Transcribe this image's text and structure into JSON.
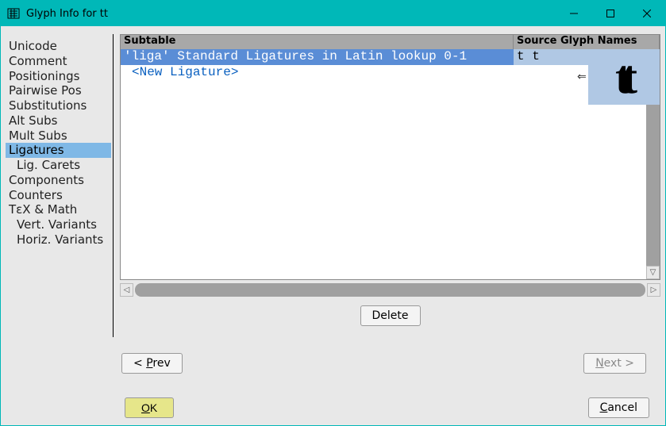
{
  "titlebar": {
    "title": "Glyph Info for tt"
  },
  "sidebar": {
    "items": [
      {
        "label": "Unicode",
        "indent": false,
        "selected": false
      },
      {
        "label": "Comment",
        "indent": false,
        "selected": false
      },
      {
        "label": "Positionings",
        "indent": false,
        "selected": false
      },
      {
        "label": "Pairwise Pos",
        "indent": false,
        "selected": false
      },
      {
        "label": "Substitutions",
        "indent": false,
        "selected": false
      },
      {
        "label": "Alt Subs",
        "indent": false,
        "selected": false
      },
      {
        "label": "Mult Subs",
        "indent": false,
        "selected": false
      },
      {
        "label": "Ligatures",
        "indent": false,
        "selected": true
      },
      {
        "label": "Lig. Carets",
        "indent": true,
        "selected": false
      },
      {
        "label": "Components",
        "indent": false,
        "selected": false
      },
      {
        "label": "Counters",
        "indent": false,
        "selected": false
      },
      {
        "label": "TεX & Math",
        "indent": false,
        "selected": false
      },
      {
        "label": "Vert. Variants",
        "indent": true,
        "selected": false
      },
      {
        "label": "Horiz. Variants",
        "indent": true,
        "selected": false
      }
    ]
  },
  "table": {
    "headers": {
      "subtable": "Subtable",
      "source": "Source Glyph Names"
    },
    "rows": [
      {
        "subtable": "'liga' Standard Ligatures in Latin lookup 0-1",
        "source": "t t",
        "selected": true
      }
    ],
    "new_ligature_label": "<New Ligature>"
  },
  "preview_glyph": "tt",
  "buttons": {
    "delete": "Delete",
    "prev": "< Prev",
    "next": "Next >",
    "ok": "OK",
    "cancel": "Cancel"
  }
}
